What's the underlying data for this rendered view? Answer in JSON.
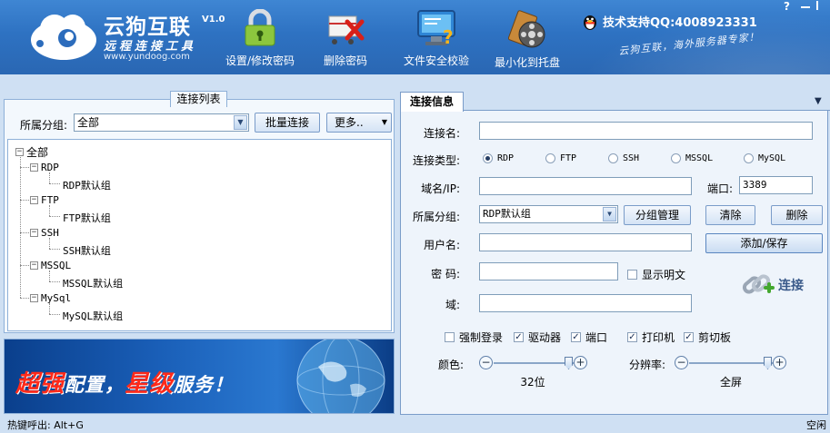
{
  "header": {
    "app_title": "云狗互联",
    "version": "V1.0",
    "subtitle": "远程连接工具",
    "website": "www.yundoog.com",
    "support": "技术支持QQ:4008923331",
    "slogan": "云狗互联，海外服务器专家！",
    "help_label": "?",
    "toolbar": {
      "password": "设置/修改密码",
      "delete_password": "删除密码",
      "verify": "文件安全校验",
      "tray": "最小化到托盘"
    }
  },
  "left": {
    "panel_title": "连接列表",
    "group_label": "所属分组:",
    "group_value": "全部",
    "batch_btn": "批量连接",
    "more_btn": "更多..",
    "tree": {
      "root": "全部",
      "groups": [
        {
          "name": "RDP",
          "child": "RDP默认组"
        },
        {
          "name": "FTP",
          "child": "FTP默认组"
        },
        {
          "name": "SSH",
          "child": "SSH默认组"
        },
        {
          "name": "MSSQL",
          "child": "MSSQL默认组"
        },
        {
          "name": "MySql",
          "child": "MySQL默认组"
        }
      ]
    },
    "banner": {
      "red1": "超强",
      "white1": "配置，",
      "red2": "星级",
      "white2": "服务！"
    }
  },
  "right": {
    "tab": "连接信息",
    "labels": {
      "name": "连接名:",
      "type": "连接类型:",
      "host": "域名/IP:",
      "port": "端口:",
      "group": "所属分组:",
      "user": "用户名:",
      "password": "密 码:",
      "domain": "域:",
      "color": "颜色:",
      "resolution": "分辨率:"
    },
    "values": {
      "name": "",
      "host": "",
      "port": "3389",
      "group": "RDP默认组",
      "user": "",
      "password": "",
      "domain": ""
    },
    "types": [
      "RDP",
      "FTP",
      "SSH",
      "MSSQL",
      "MySQL"
    ],
    "selected_type": "RDP",
    "buttons": {
      "group_manage": "分组管理",
      "clear": "清除",
      "delete": "删除",
      "add_save": "添加/保存",
      "connect": "连接"
    },
    "show_plain": "显示明文",
    "options": [
      {
        "label": "强制登录",
        "checked": false
      },
      {
        "label": "驱动器",
        "checked": true
      },
      {
        "label": "端口",
        "checked": true
      },
      {
        "label": "打印机",
        "checked": true
      },
      {
        "label": "剪切板",
        "checked": true
      }
    ],
    "color_value": "32位",
    "resolution_value": "全屏",
    "color_level": 1.0,
    "resolution_level": 1.0
  },
  "status": {
    "hotkey": "热键呼出: Alt+G",
    "state": "空闲"
  }
}
